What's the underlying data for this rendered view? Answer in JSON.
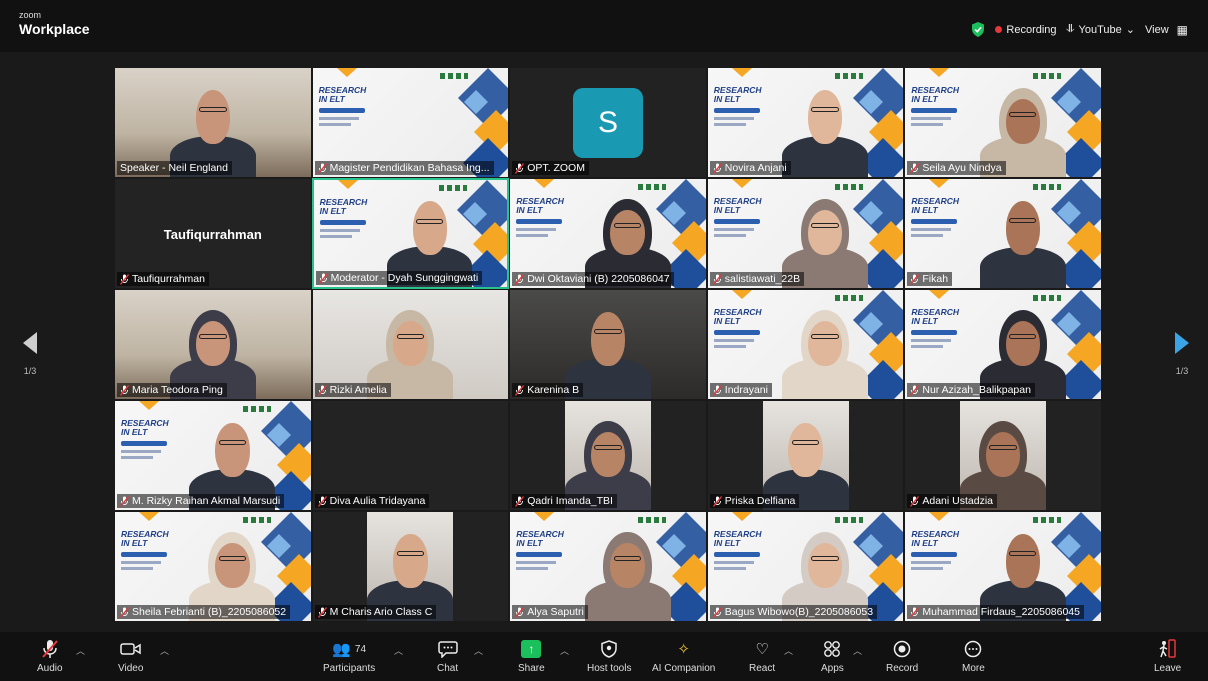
{
  "app": {
    "brand_small": "zoom",
    "brand_big": "Workplace",
    "recording": "Recording",
    "youtube": "YouTube",
    "view": "View"
  },
  "navigation": {
    "left_page": "1/3",
    "right_page": "1/3"
  },
  "tiles": [
    {
      "name": "Speaker - Neil England",
      "kind": "cam"
    },
    {
      "name": "Magister Pendidikan Bahasa Ing...",
      "kind": "slide"
    },
    {
      "name": "OPT. ZOOM",
      "kind": "avatar",
      "initial": "S"
    },
    {
      "name": "Novira Anjani",
      "kind": "slide-person"
    },
    {
      "name": "Seila Ayu Nindya",
      "kind": "slide-person"
    },
    {
      "name": "Taufiqurrahman",
      "kind": "name-only",
      "display": "Taufiqurrahman"
    },
    {
      "name": "Moderator - Dyah Sunggingwati",
      "kind": "slide-person",
      "active": true
    },
    {
      "name": "Dwi Oktaviani (B) 2205086047",
      "kind": "slide-person"
    },
    {
      "name": "salistiawati_22B",
      "kind": "slide-person"
    },
    {
      "name": "Fikah",
      "kind": "slide-person"
    },
    {
      "name": "Maria Teodora Ping",
      "kind": "cam"
    },
    {
      "name": "Rizki Amelia",
      "kind": "cam"
    },
    {
      "name": "Karenina B",
      "kind": "cam-dim"
    },
    {
      "name": "Indrayani",
      "kind": "slide-person"
    },
    {
      "name": "Nur Azizah_Balikpapan",
      "kind": "slide-person"
    },
    {
      "name": "M. Rizky Raihan Akmal Marsudi",
      "kind": "slide-person"
    },
    {
      "name": "Diva Aulia Tridayana",
      "kind": "dark"
    },
    {
      "name": "Qadri Imanda_TBI",
      "kind": "cam-narrow"
    },
    {
      "name": "Priska Delfiana",
      "kind": "cam-narrow"
    },
    {
      "name": "Adani Ustadzia",
      "kind": "cam-narrow"
    },
    {
      "name": "Sheila Febrianti (B)_2205086052",
      "kind": "slide-person"
    },
    {
      "name": "M Charis Ario Class C",
      "kind": "cam-narrow"
    },
    {
      "name": "Alya Saputri",
      "kind": "slide-person"
    },
    {
      "name": "Bagus Wibowo(B)_2205086053",
      "kind": "slide-person"
    },
    {
      "name": "Muhammad Firdaus_2205086045",
      "kind": "slide-person"
    }
  ],
  "slide_title": "RESEARCH\nIN ELT",
  "toolbar": {
    "audio": "Audio",
    "video": "Video",
    "participants": "Participants",
    "participant_count": "74",
    "chat": "Chat",
    "share": "Share",
    "host_tools": "Host tools",
    "ai_companion": "AI Companion",
    "react": "React",
    "apps": "Apps",
    "record": "Record",
    "more": "More",
    "leave": "Leave"
  },
  "colors": {
    "accent": "#1bbf5b",
    "record_red": "#e5383b",
    "active_border": "#29c18c",
    "avatar_teal": "#1a9ab2"
  }
}
